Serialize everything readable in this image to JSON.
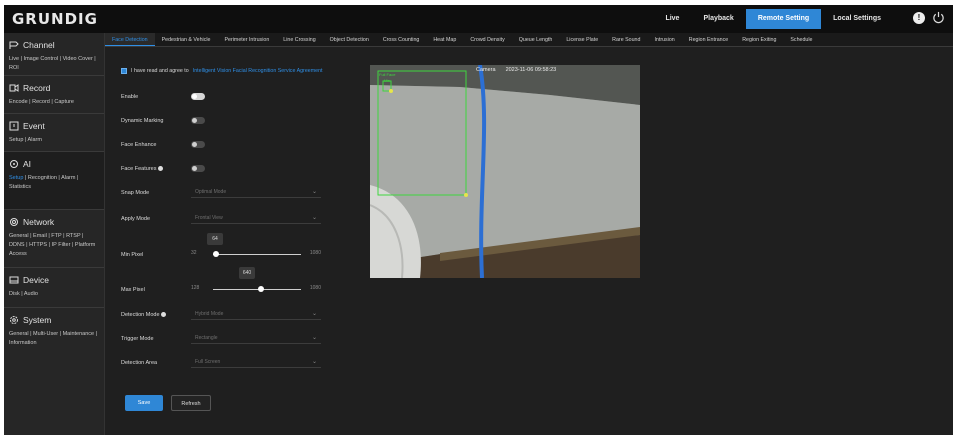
{
  "brand": "GRUNDIG",
  "topnav": [
    "Live",
    "Playback",
    "Remote Setting",
    "Local Settings"
  ],
  "topnav_active": 2,
  "colors": {
    "accent": "#2f87d6",
    "link": "#2f8fe6",
    "roi": "#3fd63f",
    "knob": "#e6e64a"
  },
  "sidebar": [
    {
      "title": "Channel",
      "icon": "channel-icon",
      "links": "Live | Image Control | Video Cover | ROI"
    },
    {
      "title": "Record",
      "icon": "record-icon",
      "links": "Encode | Record | Capture"
    },
    {
      "title": "Event",
      "icon": "event-icon",
      "links": "Setup | Alarm"
    },
    {
      "title": "AI",
      "icon": "ai-icon",
      "links_active": "Setup",
      "links": " | Recognition | Alarm | Statistics"
    },
    {
      "title": "Network",
      "icon": "network-icon",
      "links": "General | Email | FTP | RTSP | DDNS | HTTPS | IP Filter | Platform Access"
    },
    {
      "title": "Device",
      "icon": "device-icon",
      "links": "Disk | Audio"
    },
    {
      "title": "System",
      "icon": "system-icon",
      "links": "General | Multi-User | Maintenance | Information"
    }
  ],
  "tabs": [
    "Face Detection",
    "Pedestrian & Vehicle",
    "Perimeter Intrusion",
    "Line Crossing",
    "Object Detection",
    "Cross Counting",
    "Heat Map",
    "Crowd Density",
    "Queue Length",
    "License Plate",
    "Rare Sound",
    "Intrusion",
    "Region Entrance",
    "Region Exiting",
    "Schedule"
  ],
  "tabs_active": 0,
  "agree": {
    "text": "I have read and agree to ",
    "link": "Intelligent Vision Facial Recognition Service Agreement",
    "checked": true
  },
  "form": {
    "enable_label": "Enable",
    "enable": true,
    "dynamic_label": "Dynamic Marking",
    "dynamic": false,
    "enhance_label": "Face Enhance",
    "enhance": false,
    "features_label": "Face Features",
    "features": false,
    "snap_label": "Snap Mode",
    "snap_value": "Optimal Mode",
    "apply_label": "Apply Mode",
    "apply_value": "Frontal View",
    "minpx_label": "Min Pixel",
    "minpx_value": "64",
    "minpx_min": "32",
    "minpx_max": "1080",
    "minpx_frac": 0.03,
    "maxpx_label": "Max Pixel",
    "maxpx_value": "640",
    "maxpx_min": "128",
    "maxpx_max": "1080",
    "maxpx_frac": 0.54,
    "detmode_label": "Detection Mode",
    "detmode_value": "Hybrid Mode",
    "trigger_label": "Trigger Mode",
    "trigger_value": "Rectangle",
    "area_label": "Detection Area",
    "area_value": "Full Screen"
  },
  "buttons": {
    "save": "Save",
    "refresh": "Refresh"
  },
  "video": {
    "channel": "Camera",
    "timestamp": "2023-11-06 09:58:23",
    "roi_full": "Full Face",
    "roi_min": "Min"
  }
}
